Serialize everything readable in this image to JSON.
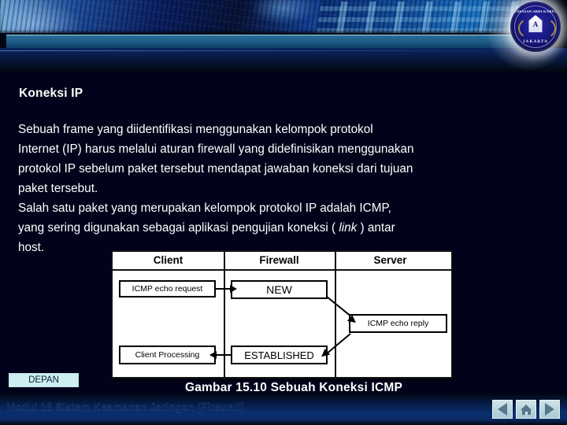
{
  "banner": {
    "logo": {
      "top_text": "YAYASAN ABDI KARYA",
      "bottom_text": "JAKARTA",
      "center_letter": "A"
    }
  },
  "slide": {
    "heading": "Koneksi IP",
    "paragraph_lines": [
      "Sebuah frame yang diidentifikasi menggunakan kelompok protokol",
      "Internet (IP) harus melalui aturan firewall yang didefinisikan menggunakan",
      "protokol IP sebelum paket tersebut mendapat jawaban koneksi dari tujuan",
      "paket tersebut.",
      "Salah satu paket yang merupakan kelompok protokol IP adalah ICMP,",
      "yang sering digunakan sebagai aplikasi pengujian koneksi ( link ) antar",
      "host."
    ],
    "paragraph_italic_word": "link",
    "caption": "Gambar 15.10 Sebuah Koneksi ICMP"
  },
  "figure": {
    "columns": [
      "Client",
      "Firewall",
      "Server"
    ],
    "nodes": {
      "icmp_echo_request": "ICMP echo request",
      "new": "NEW",
      "icmp_echo_reply": "ICMP echo reply",
      "client_processing": "Client Processing",
      "established": "ESTABLISHED"
    }
  },
  "controls": {
    "depan_label": "DEPAN",
    "nav": {
      "prev": "prev-arrow-icon",
      "home": "home-icon",
      "next": "next-arrow-icon"
    }
  },
  "footer": {
    "text": "Modul 15 Sistem Keamanan Jaringan (Firewall)"
  },
  "colors": {
    "slide_background": "#02031a",
    "text": "#ffffff",
    "depan_background": "#cdeff0",
    "footer_text": "#0d2c5e",
    "figure_background": "#ffffff"
  }
}
